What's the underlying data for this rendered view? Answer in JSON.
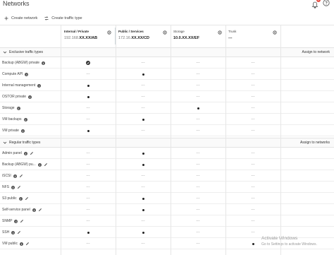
{
  "header": {
    "title": "Networks",
    "notification_count": "2"
  },
  "toolbar": {
    "create_network": "Create network",
    "create_traffic_type": "Create traffic type"
  },
  "networks": [
    {
      "name": "Internal / Private",
      "prefix": "192.168.",
      "suffix": "XX.XX/AB",
      "selected": true
    },
    {
      "name": "Public / Services",
      "prefix": "172.16.",
      "suffix": "XX.XX/CD",
      "selected": false
    },
    {
      "name": "Storage",
      "prefix": "",
      "suffix": "10.0.XX.XX/EF",
      "selected": false
    },
    {
      "name": "Trunk",
      "prefix": "",
      "suffix": "---",
      "selected": false
    }
  ],
  "exclusive": {
    "title": "Exclusive traffic types",
    "action": "Assign to network",
    "rows": [
      {
        "label": "Backup (ABGW) private",
        "editable": false,
        "cells": [
          "check",
          "empty",
          "empty",
          "empty"
        ]
      },
      {
        "label": "Compute API",
        "editable": false,
        "cells": [
          "empty",
          "dot",
          "empty",
          "empty"
        ]
      },
      {
        "label": "Internal management",
        "editable": false,
        "cells": [
          "dot",
          "empty",
          "empty",
          "empty"
        ]
      },
      {
        "label": "OSTOR private",
        "editable": false,
        "cells": [
          "dot",
          "empty",
          "empty",
          "empty"
        ]
      },
      {
        "label": "Storage",
        "editable": false,
        "cells": [
          "empty",
          "empty",
          "dot",
          "empty"
        ]
      },
      {
        "label": "VM backups",
        "editable": false,
        "cells": [
          "empty",
          "dot",
          "empty",
          "empty"
        ]
      },
      {
        "label": "VM private",
        "editable": false,
        "cells": [
          "dot",
          "empty",
          "empty",
          "empty"
        ]
      }
    ]
  },
  "regular": {
    "title": "Regular traffic types",
    "action": "Assign to networks",
    "rows": [
      {
        "label": "Admin panel",
        "editable": true,
        "cells": [
          "empty",
          "dot",
          "empty",
          "empty"
        ]
      },
      {
        "label": "Backup (ABGW) pu...",
        "editable": true,
        "cells": [
          "empty",
          "dot",
          "empty",
          "empty"
        ]
      },
      {
        "label": "iSCSI",
        "editable": true,
        "cells": [
          "empty",
          "empty",
          "empty",
          "empty"
        ]
      },
      {
        "label": "NFS",
        "editable": true,
        "cells": [
          "empty",
          "empty",
          "empty",
          "empty"
        ]
      },
      {
        "label": "S3 public",
        "editable": true,
        "cells": [
          "empty",
          "dot",
          "empty",
          "empty"
        ]
      },
      {
        "label": "Self-service panel",
        "editable": true,
        "cells": [
          "empty",
          "dot",
          "empty",
          "empty"
        ]
      },
      {
        "label": "SNMP",
        "editable": true,
        "cells": [
          "empty",
          "empty",
          "empty",
          "empty"
        ]
      },
      {
        "label": "SSH",
        "editable": true,
        "cells": [
          "dot",
          "dot",
          "empty",
          "empty"
        ]
      },
      {
        "label": "VM public",
        "editable": true,
        "cells": [
          "empty",
          "empty",
          "empty",
          "dot"
        ]
      }
    ]
  },
  "empty_marker": "---",
  "watermark": {
    "line1": "Activate Windows",
    "line2": "Go to Settings to activate Windows."
  },
  "colors": {
    "dot": "#222222",
    "badge": "#e54d42",
    "divider": "#e6e6e6"
  }
}
